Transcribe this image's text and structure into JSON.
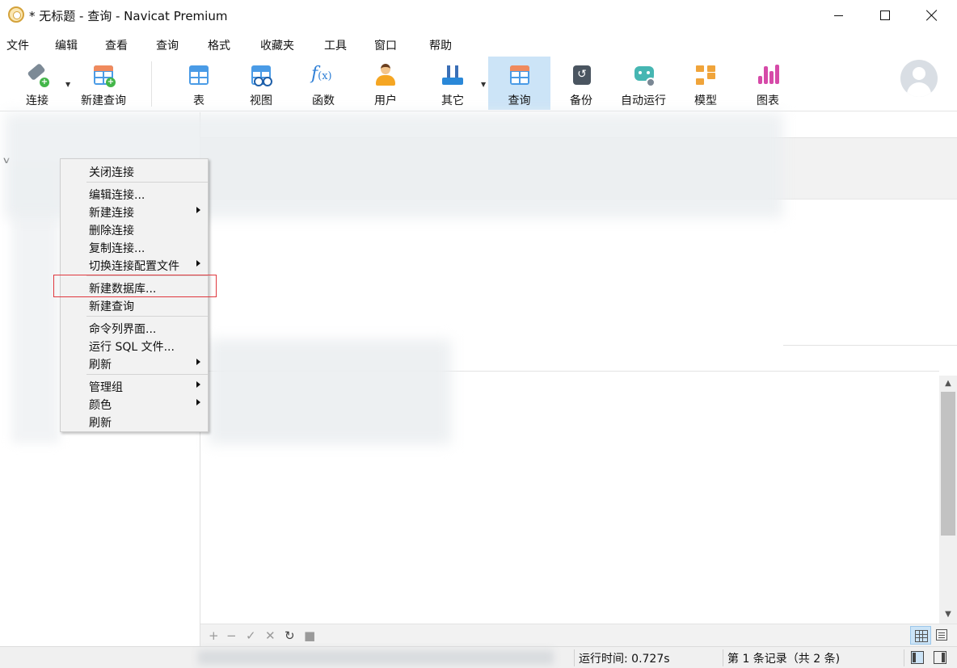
{
  "window": {
    "title": "* 无标题 - 查询 - Navicat Premium"
  },
  "menubar": {
    "items": [
      "文件",
      "编辑",
      "查看",
      "查询",
      "格式",
      "收藏夹",
      "工具",
      "窗口",
      "帮助"
    ]
  },
  "toolbar": {
    "buttons": [
      {
        "label": "连接",
        "icon": "connect-plug-icon"
      },
      {
        "label": "新建查询",
        "icon": "new-query-icon"
      },
      {
        "label": "表",
        "icon": "table-icon"
      },
      {
        "label": "视图",
        "icon": "view-icon"
      },
      {
        "label": "函数",
        "icon": "function-icon"
      },
      {
        "label": "用户",
        "icon": "user-icon"
      },
      {
        "label": "其它",
        "icon": "other-tools-icon"
      },
      {
        "label": "查询",
        "icon": "query-icon",
        "active": true
      },
      {
        "label": "备份",
        "icon": "backup-icon"
      },
      {
        "label": "自动运行",
        "icon": "automation-icon"
      },
      {
        "label": "模型",
        "icon": "model-icon"
      },
      {
        "label": "图表",
        "icon": "chart-icon"
      }
    ],
    "fx_glyph": "f",
    "fx_sub": "(x)",
    "backup_glyph": "↺"
  },
  "context_menu": {
    "items": [
      {
        "label": "关闭连接",
        "submenu": false
      },
      {
        "label": "编辑连接...",
        "submenu": false
      },
      {
        "label": "新建连接",
        "submenu": true
      },
      {
        "label": "删除连接",
        "submenu": false
      },
      {
        "label": "复制连接...",
        "submenu": false
      },
      {
        "label": "切换连接配置文件",
        "submenu": true
      },
      {
        "label": "新建数据库...",
        "submenu": false,
        "highlighted": true
      },
      {
        "label": "新建查询",
        "submenu": false
      },
      {
        "label": "命令列界面...",
        "submenu": false
      },
      {
        "label": "运行 SQL 文件...",
        "submenu": false
      },
      {
        "label": "刷新",
        "submenu": true
      },
      {
        "label": "管理组",
        "submenu": true
      },
      {
        "label": "颜色",
        "submenu": true
      },
      {
        "label": "刷新",
        "submenu": false
      }
    ],
    "highlight_color": "#e0383e"
  },
  "results_toolbar": {
    "icons": [
      "+",
      "−",
      "✓",
      "✕",
      "↻",
      "■"
    ]
  },
  "statusbar": {
    "run_time": "运行时间: 0.727s",
    "record": "第 1 条记录（共 2 条)"
  },
  "colors": {
    "accent": "#cce4f7",
    "toolbar_bg": "#ffffff",
    "status_bg": "#f0f0f0"
  }
}
